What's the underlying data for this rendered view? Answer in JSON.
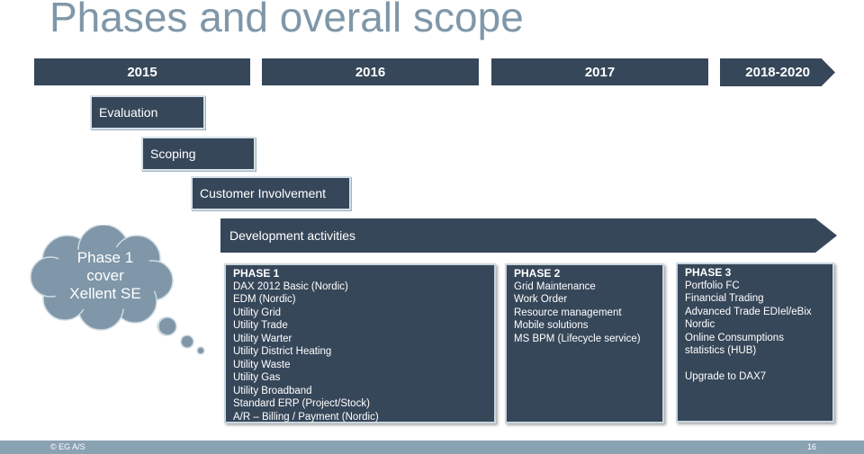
{
  "title": "Phases and overall scope",
  "timeline": {
    "years": [
      "2015",
      "2016",
      "2017",
      "2018-2020"
    ]
  },
  "activities": {
    "evaluation": "Evaluation",
    "scoping": "Scoping",
    "customer_involvement": "Customer Involvement",
    "development": "Development activities"
  },
  "cloud": {
    "lines": [
      "Phase 1",
      "cover",
      "Xellent SE"
    ]
  },
  "phases": [
    {
      "title": "PHASE 1",
      "items": [
        "DAX 2012 Basic (Nordic)",
        "EDM (Nordic)",
        "Utility Grid",
        "Utility Trade",
        "Utility Warter",
        "Utility District Heating",
        "Utility Waste",
        "Utility Gas",
        "Utility Broadband",
        "Standard ERP (Project/Stock)",
        "A/R – Billing / Payment (Nordic)"
      ]
    },
    {
      "title": "PHASE 2",
      "items": [
        "Grid Maintenance",
        "Work Order",
        "Resource management",
        "Mobile solutions",
        "MS BPM (Lifecycle service)"
      ]
    },
    {
      "title": "PHASE 3",
      "items": [
        "Portfolio FC",
        "Financial Trading",
        "Advanced Trade EDIel/eBix",
        "Nordic",
        "Online Consumptions",
        "statistics (HUB)",
        "",
        "Upgrade to DAX7"
      ]
    }
  ],
  "footer": {
    "copyright": "© EG A/S",
    "page_number": "16"
  },
  "colors": {
    "box": "#37475a",
    "title": "#7f97a8",
    "cloud": "#7f97a8",
    "footer": "#8aa3b3"
  }
}
